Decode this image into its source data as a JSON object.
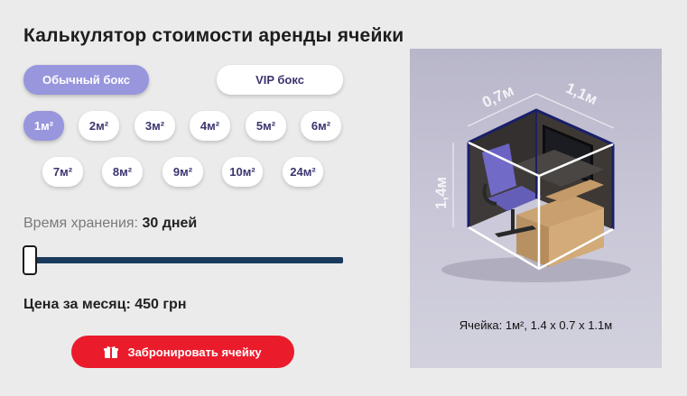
{
  "calculator": {
    "title": "Калькулятор стоимости аренды ячейки",
    "box_types": [
      {
        "label": "Обычный бокс",
        "active": true
      },
      {
        "label": "VIP бокс",
        "active": false
      }
    ],
    "sizes": [
      "1м²",
      "2м²",
      "3м²",
      "4м²",
      "5м²",
      "6м²",
      "7м²",
      "8м²",
      "9м²",
      "10м²",
      "24м²"
    ],
    "selected_size": "1м²",
    "storage": {
      "label": "Время хранения:",
      "value": "30 дней",
      "slider_fraction": 0.0
    },
    "price": "Цена за месяц: 450 грн",
    "book_button": {
      "label": "Забронировать ячейку",
      "icon": "gift-icon"
    }
  },
  "cell_preview": {
    "dim_depth": "0,7м",
    "dim_width": "1,1м",
    "dim_height": "1,4м",
    "caption": "Ячейка: 1м², 1.4 x 0.7 x 1.1м"
  },
  "colors": {
    "accent": "#9896dd",
    "book_button": "#ea1c2c",
    "slider_track": "#1a3a5c",
    "chip_text": "#3a3570"
  }
}
